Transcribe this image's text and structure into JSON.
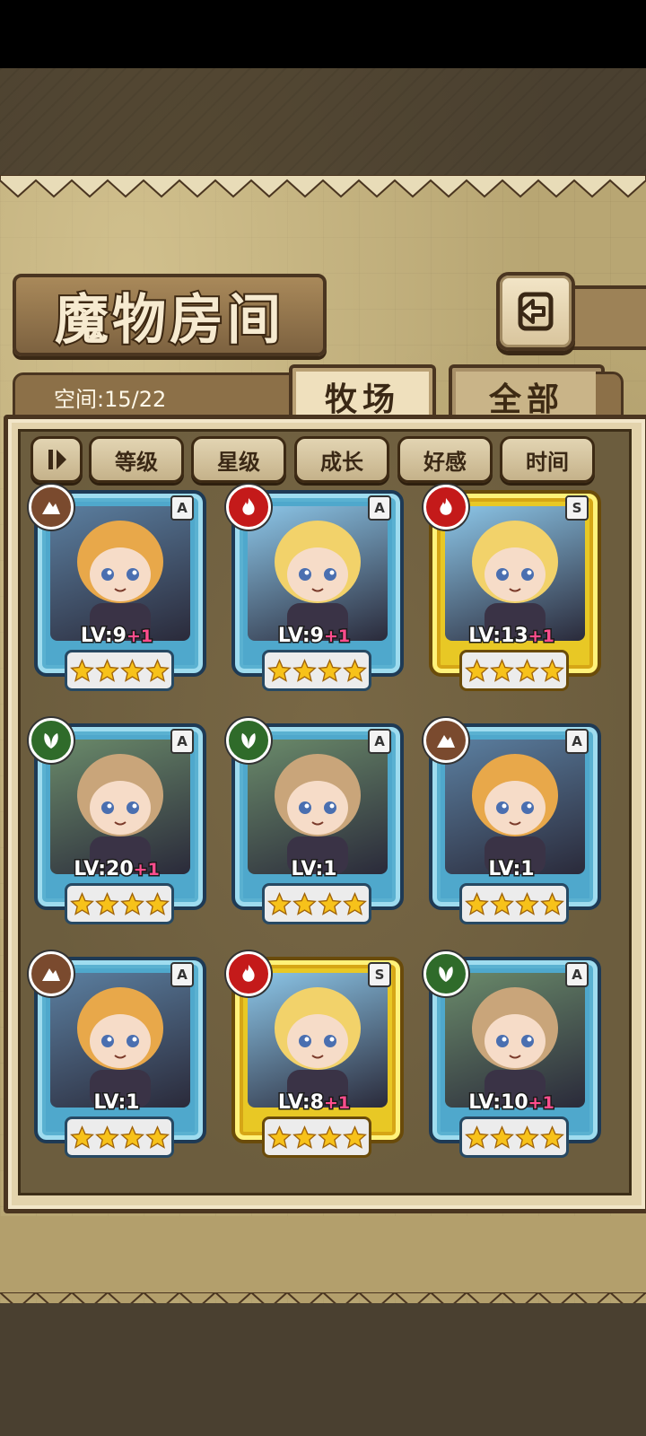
{
  "header": {
    "title": "魔物房间",
    "back_icon": "return-arrow-icon"
  },
  "capacity": {
    "label": "空间:15/22"
  },
  "tabs": [
    {
      "label": "牧场",
      "active": true
    },
    {
      "label": "全部",
      "active": false
    }
  ],
  "sort": {
    "toggle_icon": "sort-toggle-icon",
    "buttons": [
      "等级",
      "星级",
      "成长",
      "好感",
      "时间"
    ]
  },
  "monsters": [
    {
      "element": "earth",
      "rank": "A",
      "level": "LV:9",
      "bonus": "+1",
      "stars": 4,
      "frame": "blue"
    },
    {
      "element": "fire",
      "rank": "A",
      "level": "LV:9",
      "bonus": "+1",
      "stars": 4,
      "frame": "blue"
    },
    {
      "element": "fire",
      "rank": "S",
      "level": "LV:13",
      "bonus": "+1",
      "stars": 4,
      "frame": "gold"
    },
    {
      "element": "grass",
      "rank": "A",
      "level": "LV:20",
      "bonus": "+1",
      "stars": 4,
      "frame": "blue"
    },
    {
      "element": "grass",
      "rank": "A",
      "level": "LV:1",
      "bonus": "",
      "stars": 4,
      "frame": "blue"
    },
    {
      "element": "earth",
      "rank": "A",
      "level": "LV:1",
      "bonus": "",
      "stars": 4,
      "frame": "blue"
    },
    {
      "element": "earth",
      "rank": "A",
      "level": "LV:1",
      "bonus": "",
      "stars": 4,
      "frame": "blue"
    },
    {
      "element": "fire",
      "rank": "S",
      "level": "LV:8",
      "bonus": "+1",
      "stars": 4,
      "frame": "gold"
    },
    {
      "element": "grass",
      "rank": "A",
      "level": "LV:10",
      "bonus": "+1",
      "stars": 4,
      "frame": "blue"
    }
  ],
  "colors": {
    "earth": "#7a4a2e",
    "fire": "#c41a1a",
    "grass": "#2f6b2a",
    "frame_blue": "#4fa8cc",
    "frame_gold": "#e8c825",
    "star": "#f7c21a",
    "bonus": "#ff4d8d"
  }
}
